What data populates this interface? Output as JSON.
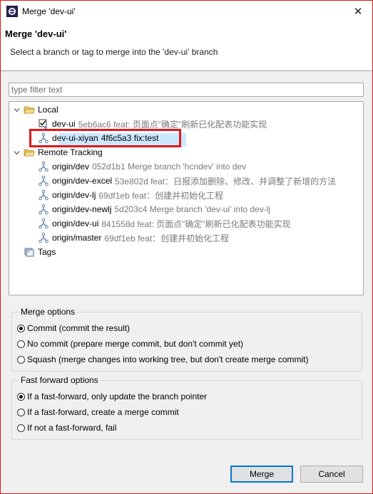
{
  "window": {
    "title": "Merge 'dev-ui'",
    "close_glyph": "✕"
  },
  "header": {
    "title": "Merge 'dev-ui'",
    "description": "Select a branch or tag to merge into the 'dev-ui' branch"
  },
  "filter": {
    "placeholder": "type filter text",
    "value": ""
  },
  "tree": {
    "local": {
      "label": "Local",
      "items": [
        {
          "name": "dev-ui",
          "meta": "5eb6ac6 feat: 页面点\"确定\"刷新已化配表功能实现",
          "checked": true
        },
        {
          "name": "dev-ui-xiyan",
          "meta": "4f6c5a3 fix:test",
          "selected": true
        }
      ]
    },
    "remote": {
      "label": "Remote Tracking",
      "items": [
        {
          "name": "origin/dev",
          "meta": "052d1b1 Merge branch 'hcndev' into dev"
        },
        {
          "name": "origin/dev-excel",
          "meta": "53e802d feat：日报添加删除、修改、并调整了新增的方法"
        },
        {
          "name": "origin/dev-lj",
          "meta": "69df1eb feat：创建并初始化工程"
        },
        {
          "name": "origin/dev-newlj",
          "meta": "5d203c4 Merge branch 'dev-ui' into dev-lj"
        },
        {
          "name": "origin/dev-ui",
          "meta": "841558d feat: 页面点\"确定\"刷新已化配表功能实现"
        },
        {
          "name": "origin/master",
          "meta": "69df1eb feat：创建并初始化工程"
        }
      ]
    },
    "tags": {
      "label": "Tags"
    }
  },
  "merge_options": {
    "label": "Merge options",
    "options": [
      {
        "label": "Commit (commit the result)",
        "selected": true
      },
      {
        "label": "No commit (prepare merge commit, but don't commit yet)",
        "selected": false
      },
      {
        "label": "Squash (merge changes into working tree, but don't create merge commit)",
        "selected": false
      }
    ]
  },
  "ff_options": {
    "label": "Fast forward options",
    "options": [
      {
        "label": "If a fast-forward, only update the branch pointer",
        "selected": true
      },
      {
        "label": "If a fast-forward, create a merge commit",
        "selected": false
      },
      {
        "label": "If not a fast-forward, fail",
        "selected": false
      }
    ]
  },
  "buttons": {
    "merge": "Merge",
    "cancel": "Cancel"
  },
  "colors": {
    "highlight": "#e0191b",
    "selection": "#cce8ff",
    "focus": "#0078d7"
  }
}
